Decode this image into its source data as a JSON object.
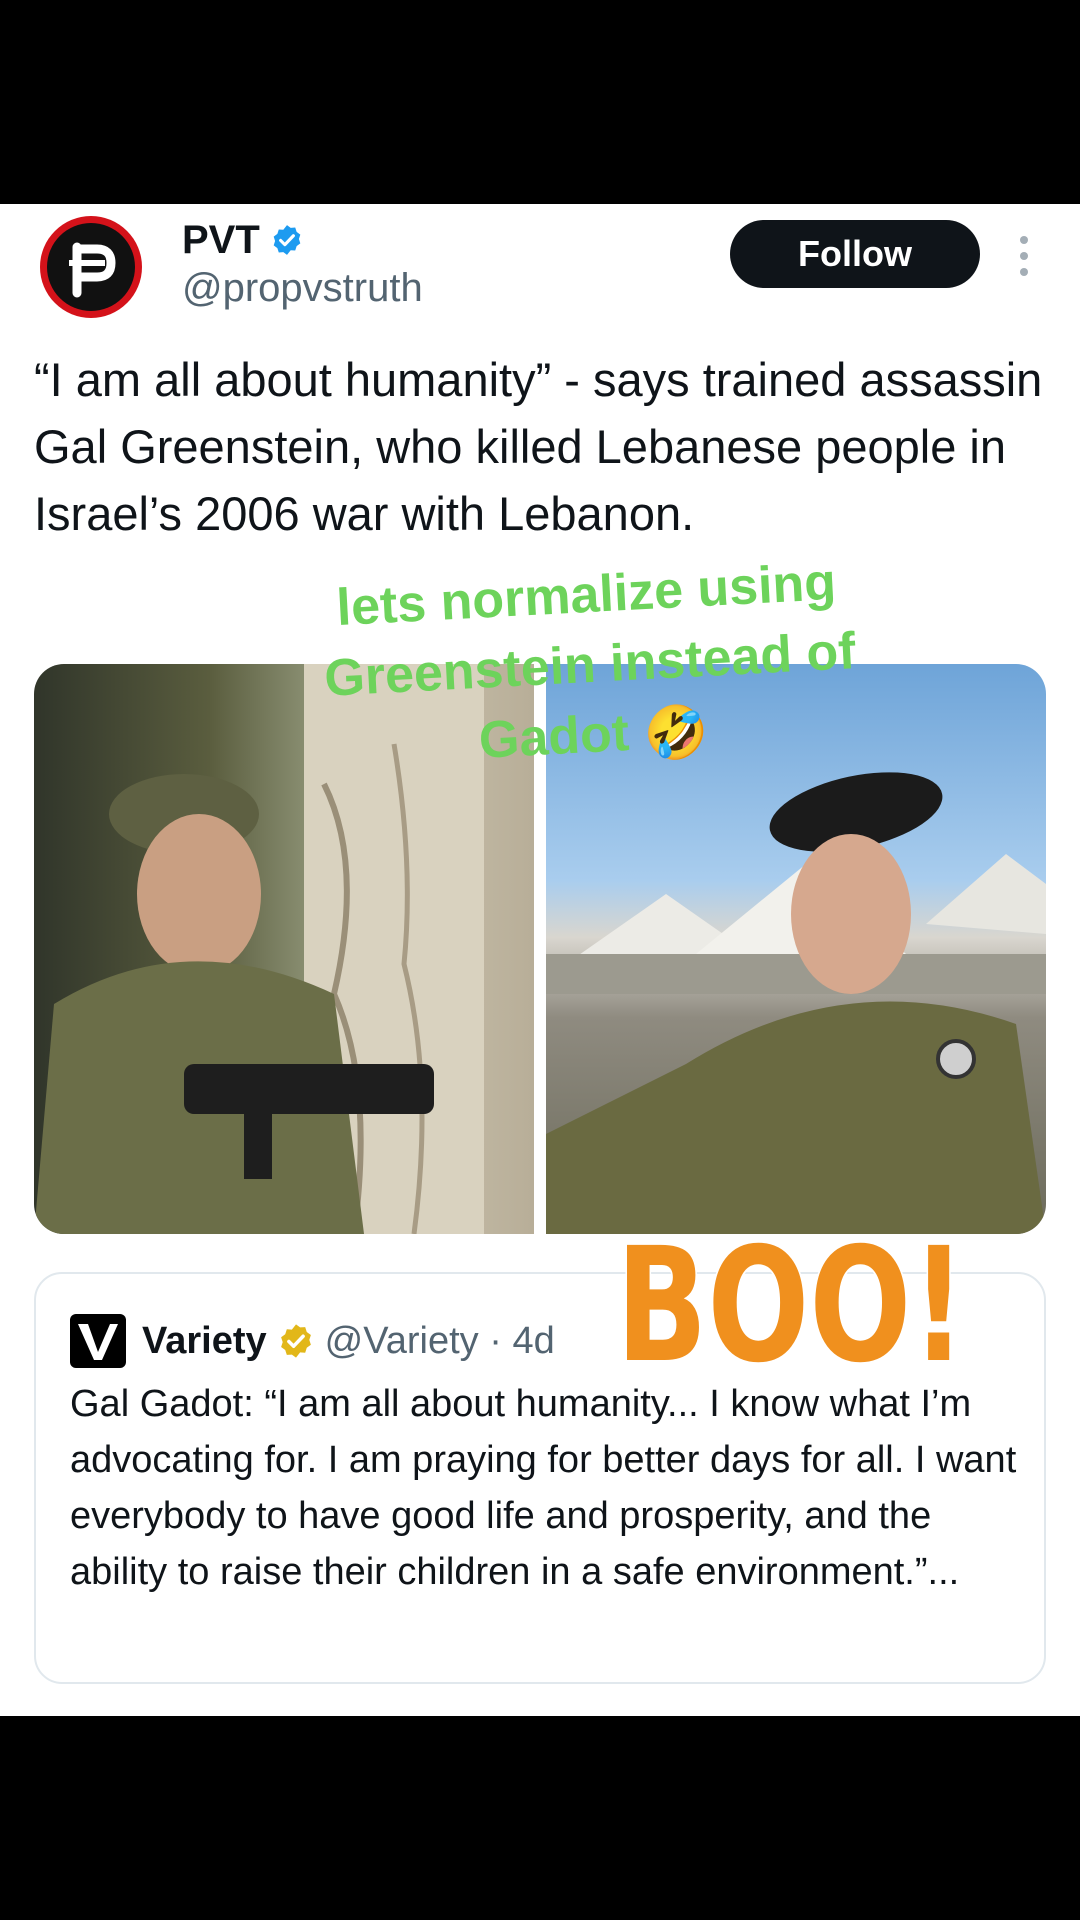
{
  "post": {
    "display_name": "PVT",
    "handle": "@propvstruth",
    "follow_label": "Follow",
    "text": "“I am all about humanity” - says trained assassin Gal Greenstein, who killed Lebanese people in Israel’s 2006 war with Lebanon."
  },
  "overlay": {
    "caption": "lets normalize using Greenstein instead of Gadot",
    "caption_emoji": "🤣",
    "sticker_text": "BOO!"
  },
  "quoted": {
    "name": "Variety",
    "handle_time": "@Variety · 4d",
    "text": "Gal Gadot: “I am all about humanity... I know what I’m advocating for. I am praying for better days for all. I want everybody to have good life and prosperity, and the ability to raise their children in a safe environment.”..."
  },
  "colors": {
    "verified_blue": "#1d9bf0",
    "verified_gold": "#e2b719",
    "caption_green": "#6dd35b",
    "sticker_orange": "#f0901e"
  },
  "icons": [
    "verified-icon",
    "more-icon",
    "variety-logo",
    "gold-verified-icon"
  ]
}
